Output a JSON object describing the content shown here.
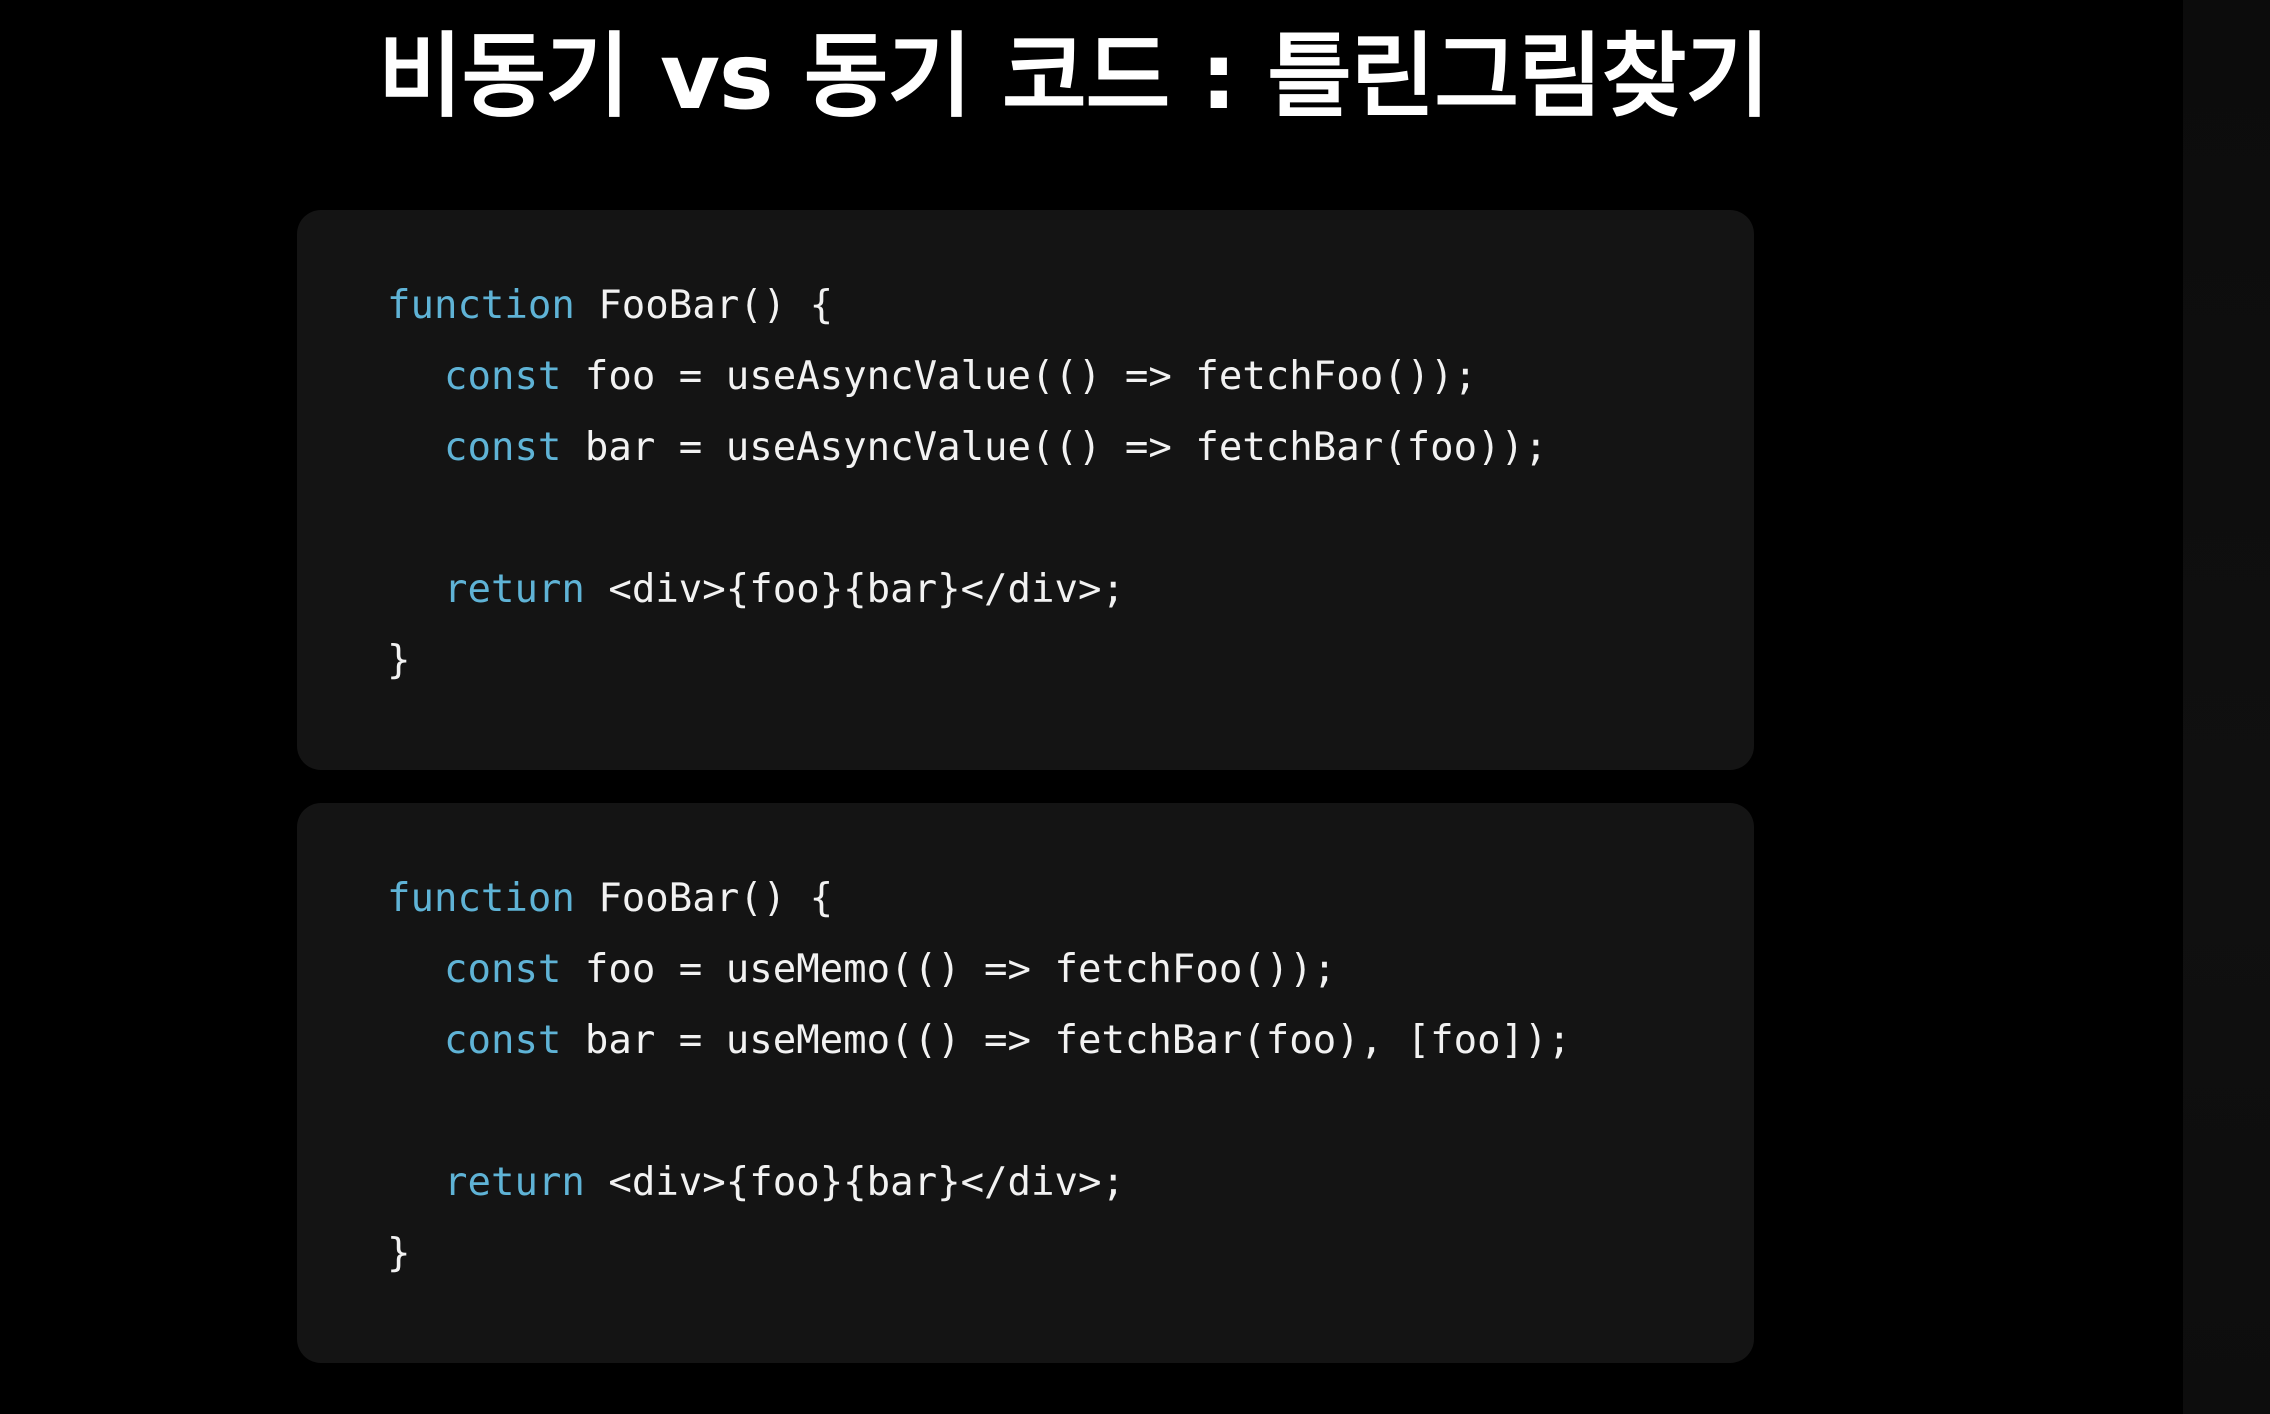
{
  "slide": {
    "title": "비동기 vs 동기 코드 : 틀린그림찾기"
  },
  "theme": {
    "background": "#000000",
    "code_background": "#141414",
    "keyword_color": "#5fb3d6",
    "text_color": "#f2f2f2"
  },
  "code_blocks": [
    {
      "lines": [
        {
          "kw": "function",
          "text": " FooBar() {"
        },
        {
          "kw": "const",
          "text": " foo = useAsyncValue(() => fetchFoo());"
        },
        {
          "kw": "const",
          "text": " bar = useAsyncValue(() => fetchBar(foo));"
        },
        {
          "kw": "",
          "text": ""
        },
        {
          "kw": "return",
          "text": " <div>{foo}{bar}</div>;"
        },
        {
          "kw": "",
          "text": "}"
        }
      ]
    },
    {
      "lines": [
        {
          "kw": "function",
          "text": " FooBar() {"
        },
        {
          "kw": "const",
          "text": " foo = useMemo(() => fetchFoo());"
        },
        {
          "kw": "const",
          "text": " bar = useMemo(() => fetchBar(foo), [foo]);"
        },
        {
          "kw": "",
          "text": ""
        },
        {
          "kw": "return",
          "text": " <div>{foo}{bar}</div>;"
        },
        {
          "kw": "",
          "text": "}"
        }
      ]
    }
  ]
}
